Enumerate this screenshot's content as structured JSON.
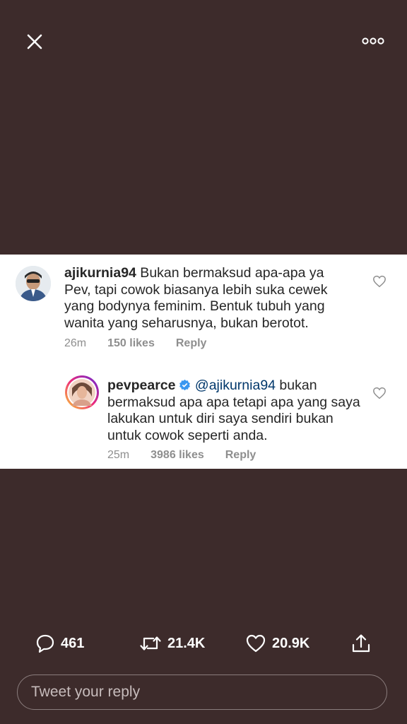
{
  "top_bar": {
    "close_icon": "close-icon",
    "more_icon": "more-dots-icon"
  },
  "media": {
    "comments": [
      {
        "username": "ajikurnia94",
        "text": " Bukan bermaksud apa-apa ya Pev, tapi cowok biasanya lebih suka cewek yang bodynya feminim. Bentuk tubuh yang wanita yang seharusnya, bukan berotot.",
        "time": "26m",
        "likes": "150 likes",
        "reply": "Reply"
      },
      {
        "username": "pevpearce",
        "verified": true,
        "mention": "@ajikurnia94",
        "text": " bukan bermaksud apa apa tetapi apa yang saya lakukan untuk diri saya sendiri bukan untuk cowok seperti anda.",
        "time": "25m",
        "likes": "3986 likes",
        "reply": "Reply"
      }
    ]
  },
  "actions": {
    "replies": "461",
    "retweets": "21.4K",
    "likes": "20.9K"
  },
  "reply_box": {
    "placeholder": "Tweet your reply"
  },
  "colors": {
    "background": "#3d2b2b",
    "accent_verified": "#3897f0",
    "mention": "#00376b"
  }
}
